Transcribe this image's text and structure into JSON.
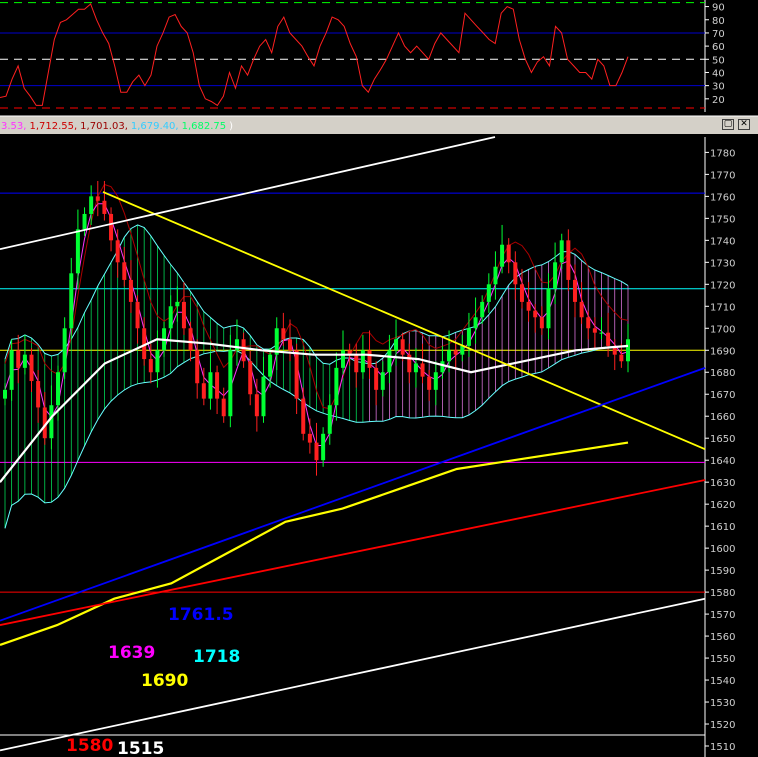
{
  "chart_data": [
    {
      "type": "line",
      "panel": "oscillator",
      "ylim": [
        10,
        95
      ],
      "yticks": [
        20,
        30,
        40,
        50,
        60,
        70,
        80,
        90
      ],
      "reference_levels": [
        {
          "value": 93,
          "color": "#00ff00",
          "style": "dashed"
        },
        {
          "value": 70,
          "color": "#0000cc",
          "style": "solid"
        },
        {
          "value": 50,
          "color": "#ffffff",
          "style": "dashed"
        },
        {
          "value": 30,
          "color": "#0000cc",
          "style": "solid"
        },
        {
          "value": 13,
          "color": "#ff0000",
          "style": "dashed"
        }
      ],
      "series": [
        {
          "color": "#ff2020",
          "values": [
            21,
            22,
            35,
            45,
            28,
            22,
            15,
            15,
            40,
            65,
            78,
            80,
            84,
            88,
            88,
            92,
            80,
            70,
            62,
            45,
            25,
            25,
            33,
            38,
            30,
            38,
            60,
            70,
            82,
            84,
            75,
            70,
            55,
            30,
            20,
            18,
            15,
            22,
            40,
            28,
            45,
            38,
            50,
            60,
            65,
            55,
            75,
            82,
            70,
            65,
            60,
            52,
            45,
            60,
            70,
            82,
            80,
            75,
            62,
            52,
            30,
            25,
            35,
            42,
            50,
            60,
            70,
            60,
            55,
            60,
            55,
            50,
            62,
            70,
            65,
            60,
            55,
            85,
            80,
            75,
            70,
            65,
            62,
            85,
            90,
            88,
            65,
            50,
            40,
            48,
            52,
            45,
            75,
            70,
            50,
            45,
            40,
            40,
            35,
            50,
            45,
            30,
            30,
            40,
            52
          ]
        }
      ]
    },
    {
      "type": "candlestick",
      "panel": "price",
      "ylim": [
        1505,
        1787
      ],
      "yticks": [
        1510,
        1520,
        1530,
        1540,
        1550,
        1560,
        1570,
        1580,
        1590,
        1600,
        1610,
        1620,
        1630,
        1640,
        1650,
        1660,
        1670,
        1680,
        1690,
        1700,
        1710,
        1720,
        1730,
        1740,
        1750,
        1760,
        1770,
        1780
      ],
      "grid": false,
      "legend_values": [
        {
          "text": "3.53,",
          "color": "#ff33ff"
        },
        {
          "text": "1,712.55,",
          "color": "#cc0000"
        },
        {
          "text": "1,701.03,",
          "color": "#990000"
        },
        {
          "text": "1,679.40,",
          "color": "#33ccff"
        },
        {
          "text": "1,682.75",
          "color": "#00ff66"
        },
        {
          "text": ")",
          "color": "#ffffff"
        }
      ],
      "close": [
        1672,
        1690,
        1682,
        1688,
        1676,
        1664,
        1650,
        1665,
        1680,
        1700,
        1725,
        1745,
        1752,
        1760,
        1758,
        1752,
        1740,
        1730,
        1722,
        1712,
        1700,
        1686,
        1680,
        1690,
        1700,
        1710,
        1712,
        1700,
        1690,
        1675,
        1668,
        1680,
        1668,
        1660,
        1690,
        1695,
        1685,
        1670,
        1660,
        1678,
        1688,
        1700,
        1695,
        1690,
        1668,
        1652,
        1648,
        1640,
        1652,
        1665,
        1682,
        1690,
        1688,
        1680,
        1690,
        1682,
        1672,
        1680,
        1690,
        1695,
        1688,
        1680,
        1684,
        1678,
        1672,
        1680,
        1685,
        1690,
        1688,
        1692,
        1700,
        1705,
        1712,
        1720,
        1728,
        1738,
        1730,
        1720,
        1712,
        1708,
        1705,
        1700,
        1718,
        1730,
        1740,
        1722,
        1712,
        1705,
        1700,
        1698,
        1698,
        1692,
        1688,
        1685,
        1695
      ],
      "horizontal_levels": [
        {
          "label": "1761.5",
          "value": 1761.5,
          "color": "#0000ff"
        },
        {
          "label": "1639",
          "value": 1639,
          "color": "#ff00ff"
        },
        {
          "label": "1718",
          "value": 1718,
          "color": "#00ffff"
        },
        {
          "label": "1690",
          "value": 1690,
          "color": "#ffff00"
        },
        {
          "label": "1580",
          "value": 1580,
          "color": "#ff0000"
        },
        {
          "label": "1515",
          "value": 1515,
          "color": "#ffffff"
        }
      ],
      "trendlines": [
        {
          "color": "#ffff00",
          "from": [
            103,
            1762
          ],
          "to": [
            705,
            1645
          ]
        },
        {
          "color": "#0000ff",
          "from": [
            0,
            1567
          ],
          "to": [
            705,
            1682
          ]
        },
        {
          "color": "#ff0000",
          "from": [
            0,
            1565
          ],
          "to": [
            705,
            1631
          ]
        },
        {
          "color": "#ffffff",
          "from": [
            0,
            1736
          ],
          "to": [
            495,
            1787
          ]
        },
        {
          "color": "#ffffff",
          "from": [
            0,
            1508
          ],
          "to": [
            705,
            1577
          ]
        }
      ],
      "moving_averages": [
        {
          "color": "#ffff00",
          "values": [
            1556,
            1565,
            1577,
            1584,
            1598,
            1612,
            1618,
            1627,
            1636,
            1640,
            1644,
            1648
          ]
        },
        {
          "color": "#ffffff",
          "values": [
            1630,
            1660,
            1684,
            1695,
            1693,
            1690,
            1688,
            1688,
            1686,
            1680,
            1685,
            1690,
            1692
          ]
        }
      ]
    }
  ]
}
